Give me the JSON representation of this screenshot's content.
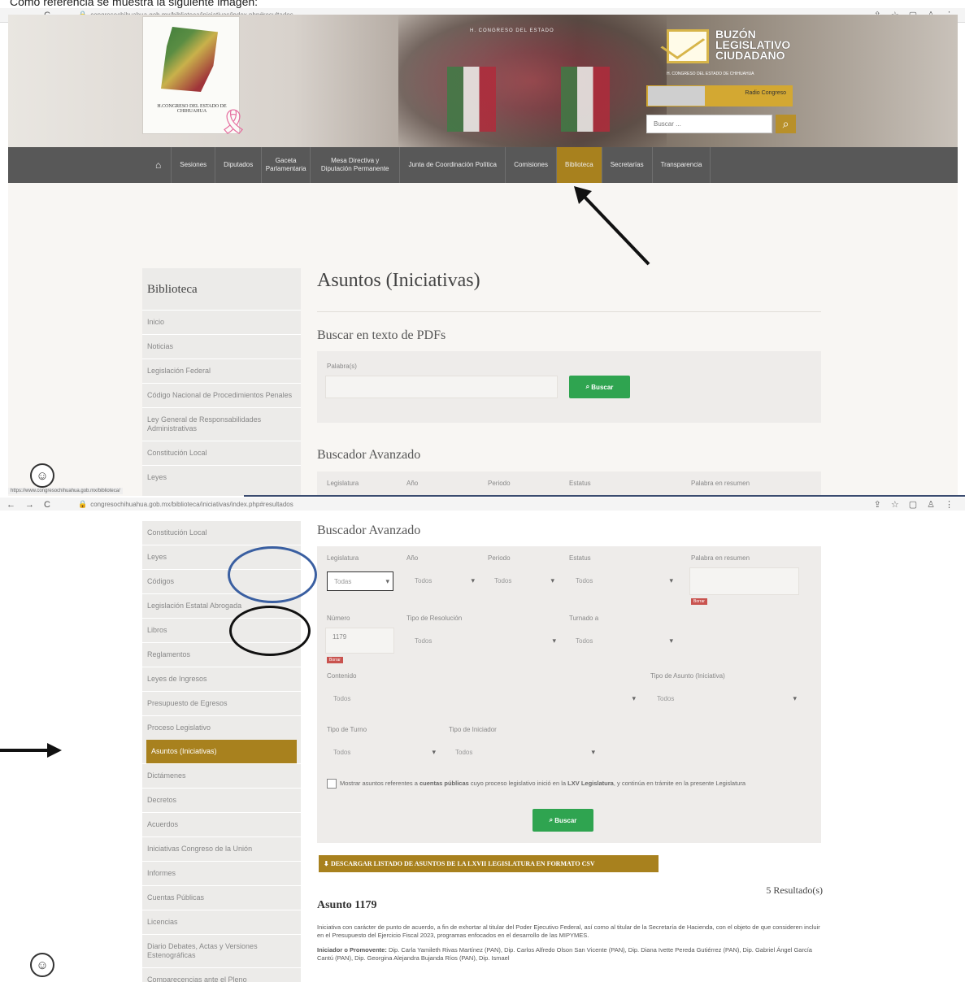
{
  "caption": "Como referencia se muestra la siguiente imagen:",
  "browser": {
    "url_top": "congresochihuahua.gob.mx/biblioteca/iniciativas/index.php#resultados",
    "url_bottom": "congresochihuahua.gob.mx/biblioteca/iniciativas/index.php#resultados",
    "status_url": "https://www.congresochihuahua.gob.mx/biblioteca/"
  },
  "header": {
    "logo_text": "H.CONGRESO DEL ESTADO DE CHIHUAHUA",
    "buzon_title": "BUZÓN LEGISLATIVO CIUDADANO",
    "buzon_sub": "H. CONGRESO DEL ESTADO DE CHIHUAHUA",
    "radio_label": "Radio Congreso",
    "search_placeholder": "Buscar ...",
    "chamber_caption": "H. CONGRESO DEL ESTADO"
  },
  "nav": [
    {
      "label": "Sesiones"
    },
    {
      "label": "Diputados"
    },
    {
      "label": "Gaceta Parlamentaria"
    },
    {
      "label": "Mesa Directiva y Diputación Permanente"
    },
    {
      "label": "Junta de Coordinación Política"
    },
    {
      "label": "Comisiones"
    },
    {
      "label": "Biblioteca"
    },
    {
      "label": "Secretarías"
    },
    {
      "label": "Transparencia"
    }
  ],
  "sidebar_top": {
    "title": "Biblioteca",
    "items": [
      "Inicio",
      "Noticias",
      "Legislación Federal",
      "Código Nacional de Procedimientos Penales",
      "Ley General de Responsabilidades Administrativas",
      "Constitución Local",
      "Leyes"
    ]
  },
  "sidebar_bottom": {
    "items": [
      "Constitución Local",
      "Leyes",
      "Códigos",
      "Legislación Estatal Abrogada",
      "Libros",
      "Reglamentos",
      "Leyes de Ingresos",
      "Presupuesto de Egresos",
      "Proceso Legislativo",
      "Asuntos (Iniciativas)",
      "Dictámenes",
      "Decretos",
      "Acuerdos",
      "Iniciativas Congreso de la Unión",
      "Informes",
      "Cuentas Públicas",
      "Licencias",
      "Diario Debates, Actas y Versiones Estenográficas",
      "Comparecencias ante el Pleno"
    ]
  },
  "main": {
    "page_title": "Asuntos (Iniciativas)",
    "pdf_search_title": "Buscar en texto de PDFs",
    "palabras_label": "Palabra(s)",
    "search_btn": "Buscar",
    "advanced_title": "Buscador Avanzado"
  },
  "advanced_top": {
    "labels": [
      "Legislatura",
      "Año",
      "Periodo",
      "Estatus",
      "Palabra en resumen"
    ]
  },
  "advanced": {
    "legislatura": "Todas",
    "anio": "Todos",
    "periodo": "Todos",
    "estatus": "Todos",
    "labels": {
      "legislatura": "Legislatura",
      "anio": "Año",
      "periodo": "Periodo",
      "estatus": "Estatus",
      "palabra": "Palabra en resumen",
      "numero": "Número",
      "tipo_resolucion": "Tipo de Resolución",
      "turnado": "Turnado a",
      "contenido": "Contenido",
      "tipo_asunto": "Tipo de Asunto (Iniciativa)",
      "tipo_turno": "Tipo de Turno",
      "tipo_iniciador": "Tipo de Iniciador"
    },
    "numero": "1179",
    "tipo_resolucion": "Todos",
    "turnado": "Todos",
    "contenido": "Todos",
    "tipo_asunto": "Todos",
    "tipo_turno": "Todos",
    "tipo_iniciador": "Todos",
    "clear": "Borrar",
    "checkbox_text_1": "Mostrar asuntos referentes a ",
    "checkbox_bold_1": "cuentas públicas",
    "checkbox_text_2": " cuyo proceso legislativo inició en la ",
    "checkbox_bold_2": "LXV Legislatura",
    "checkbox_text_3": ", y continúa en trámite en la presente Legislatura",
    "search_btn": "Buscar"
  },
  "results": {
    "download": "DESCARGAR LISTADO DE ASUNTOS DE LA LXVII LEGISLATURA EN FORMATO CSV",
    "count": "5 Resultado(s)",
    "asunto_title": "Asunto 1179",
    "asunto_desc": "Iniciativa con carácter de punto de acuerdo, a fin de exhortar al titular del Poder Ejecutivo Federal, así como al titular de la Secretaría de Hacienda, con el objeto de que consideren incluir en el Presupuesto del Ejercicio Fiscal 2023, programas enfocados en el desarrollo de las MIPYMES.",
    "iniciador_label": "Iniciador o Promovente:",
    "iniciador_text": " Dip. Carla Yamileth Rivas Martínez (PAN), Dip. Carlos Alfredo Olson San Vicente (PAN), Dip. Diana Ivette Pereda Gutiérrez (PAN), Dip. Gabriel Ángel García Cantú (PAN), Dip. Georgina Alejandra Bujanda Ríos (PAN), Dip. Ismael"
  },
  "colors": {
    "gold": "#a8811e",
    "nav": "#585858",
    "green": "#2fa450"
  }
}
